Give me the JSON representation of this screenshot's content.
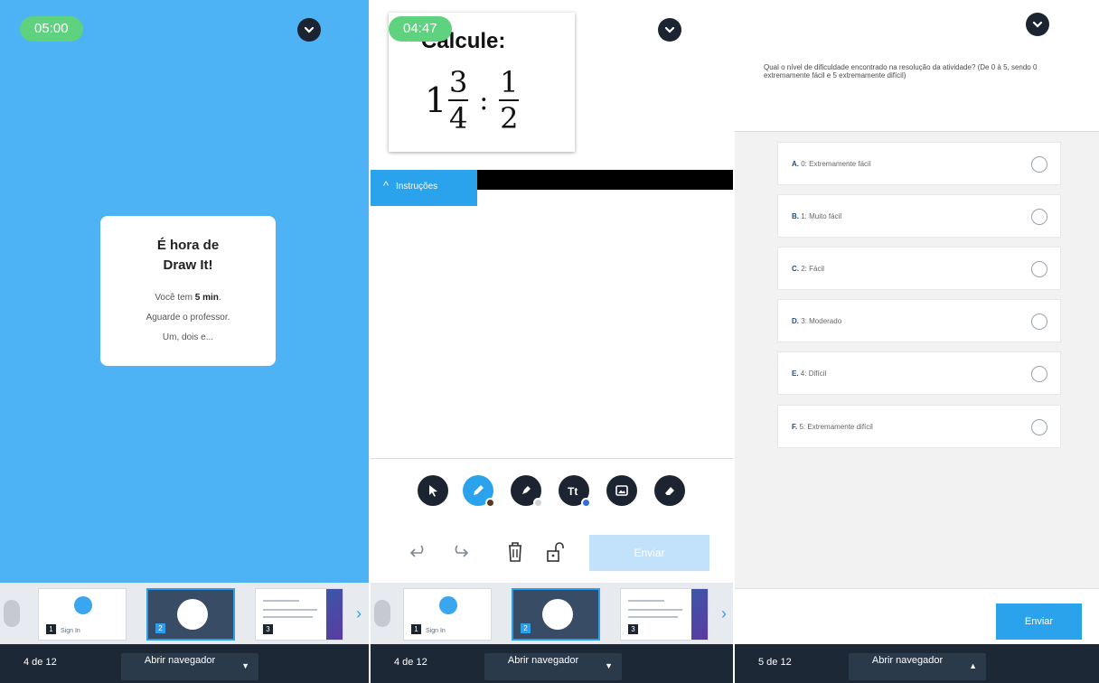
{
  "panel1": {
    "timer": "05:00",
    "card": {
      "title_line1": "É hora de",
      "title_line2": "Draw It!",
      "line1_prefix": "Você tem ",
      "line1_bold": "5 min",
      "line1_suffix": ".",
      "line2": "Aguarde o professor.",
      "line3": "Um, dois e..."
    },
    "page_count": "4 de 12",
    "nav_label": "Abrir navegador"
  },
  "panel2": {
    "timer": "04:47",
    "problem": {
      "title": "Calcule:",
      "whole": "1",
      "num1": "3",
      "den1": "4",
      "operator": ":",
      "num2": "1",
      "den2": "2"
    },
    "instructions_label": "Instruções",
    "send_label": "Enviar",
    "page_count": "4 de 12",
    "nav_label": "Abrir navegador",
    "tools": [
      "pointer-icon",
      "pen-icon",
      "highlighter-icon",
      "text-icon",
      "image-icon",
      "eraser-icon"
    ]
  },
  "thumbnails": [
    {
      "number": "1",
      "label": "Sign In"
    },
    {
      "number": "2",
      "label": ""
    },
    {
      "number": "3",
      "label": ""
    }
  ],
  "panel3": {
    "question": "Qual o nível de dificuldade encontrado na resolução da atividade? (De 0 à 5, sendo 0 extremamente fácil e 5 extremamente difícil)",
    "options": [
      {
        "letter": "A.",
        "text": "0: Extremamente fácil"
      },
      {
        "letter": "B.",
        "text": "1: Muito fácil"
      },
      {
        "letter": "C.",
        "text": "2: Fácil"
      },
      {
        "letter": "D.",
        "text": "3: Moderado"
      },
      {
        "letter": "E.",
        "text": "4: Difícil"
      },
      {
        "letter": "F.",
        "text": "5: Extremamente difícil"
      }
    ],
    "send_label": "Enviar",
    "page_count": "5 de 12",
    "nav_label": "Abrir navegador"
  },
  "colors": {
    "accent_blue": "#2aa3ec",
    "background_blue": "#4db3f5",
    "timer_green": "#5fd27f",
    "bottom_bar": "#1c2835"
  }
}
